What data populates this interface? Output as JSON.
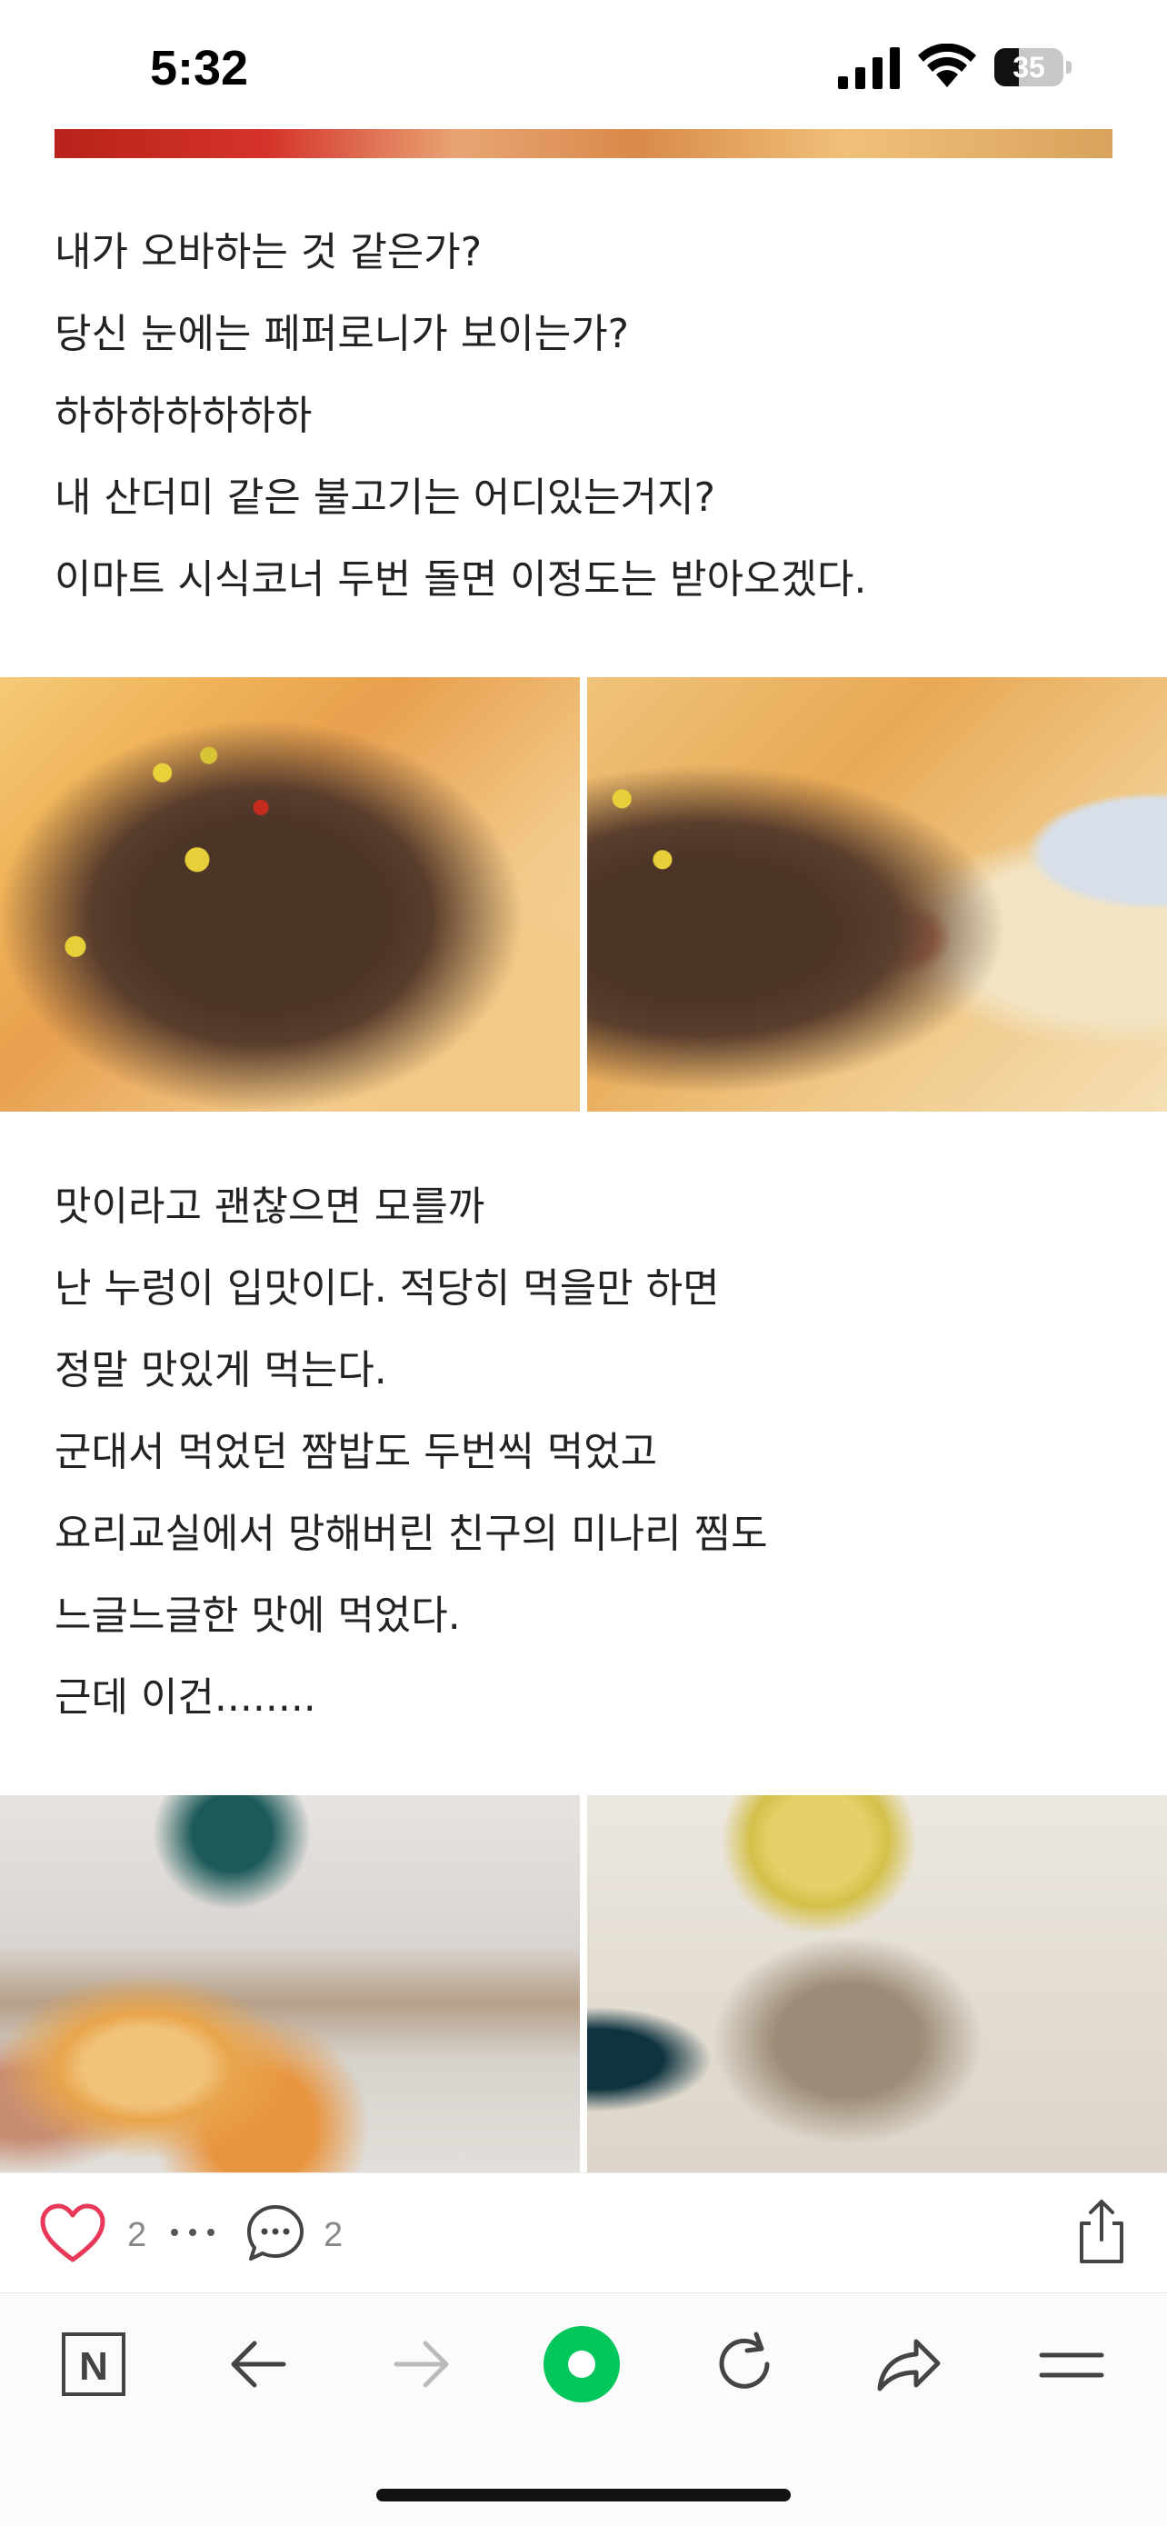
{
  "status_bar": {
    "time": "5:32",
    "battery_level": "35",
    "battery_fraction": 0.35
  },
  "post": {
    "paragraph1": [
      "내가 오바하는 것 같은가?",
      "당신 눈에는 페퍼로니가 보이는가?",
      "하하하하하하하",
      "내 산더미 같은 불고기는 어디있는거지?",
      "이마트 시식코너 두번 돌면 이정도는 받아오겠다."
    ],
    "paragraph2": [
      "맛이라고 괜찮으면 모를까",
      "난 누렁이 입맛이다. 적당히 먹을만 하면",
      "정말 맛있게 먹는다.",
      "군대서 먹었던 짬밥도 두번씩 먹었고",
      "요리교실에서 망해버린 친구의 미나리 찜도",
      "느글느글한 맛에 먹었다.",
      "근데 이건........"
    ]
  },
  "actions": {
    "like_count": "2",
    "comment_count": "2"
  },
  "toolbar": {
    "naver_logo_letter": "N"
  },
  "colors": {
    "like_heart": "#e8385a",
    "naver_green": "#03c75a",
    "icon_gray": "#444444",
    "disabled_gray": "#bbbbbb"
  }
}
